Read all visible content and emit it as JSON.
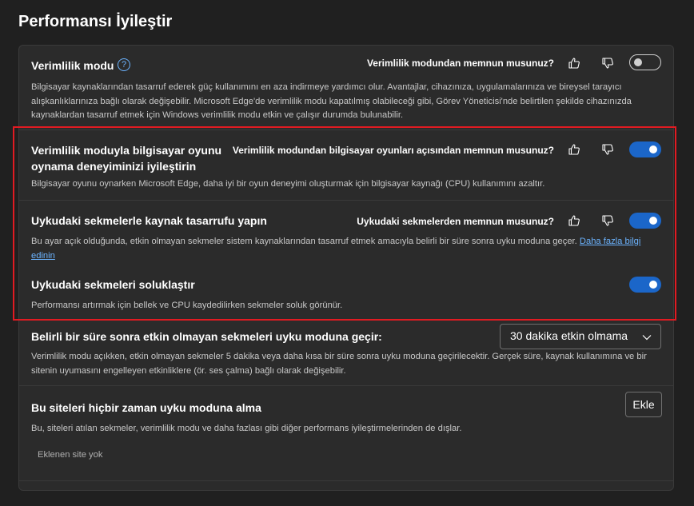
{
  "page": {
    "title": "Performansı İyileştir"
  },
  "efficiency": {
    "title": "Verimlilik modu",
    "help_icon": "help-circle-icon",
    "feedback_question": "Verimlilik modundan memnun musunuz?",
    "description": "Bilgisayar kaynaklarından tasarruf ederek güç kullanımını en aza indirmeye yardımcı olur. Avantajlar, cihazınıza, uygulamalarınıza ve bireysel tarayıcı alışkanlıklarınıza bağlı olarak değişebilir. Microsoft Edge'de verimlilik modu kapatılmış olabileceği gibi, Görev Yöneticisi'nde belirtilen şekilde cihazınızda kaynaklardan tasarruf etmek için Windows verimlilik modu etkin ve çalışır durumda bulunabilir.",
    "toggle_on": false
  },
  "gaming": {
    "title_line1": "Verimlilik moduyla bilgisayar oyunu",
    "title_line2": "oynama deneyiminizi iyileştirin",
    "feedback_question": "Verimlilik modundan bilgisayar oyunları açısından memnun musunuz?",
    "description": "Bilgisayar oyunu oynarken Microsoft Edge, daha iyi bir oyun deneyimi oluşturmak için bilgisayar kaynağı (CPU) kullanımını azaltır.",
    "toggle_on": true
  },
  "sleeping_tabs": {
    "title": "Uykudaki sekmelerle kaynak tasarrufu yapın",
    "feedback_question": "Uykudaki sekmelerden memnun musunuz?",
    "description": "Bu ayar açık olduğunda, etkin olmayan sekmeler sistem kaynaklarından tasarruf etmek amacıyla belirli bir süre sonra uyku moduna geçer.",
    "link_text": "Daha fazla bilgi edinin",
    "toggle_on": true
  },
  "fade_tabs": {
    "title": "Uykudaki sekmeleri soluklaştır",
    "description": "Performansı artırmak için bellek ve CPU kaydedilirken sekmeler soluk görünür.",
    "toggle_on": true
  },
  "sleep_after": {
    "title": "Belirli bir süre sonra etkin olmayan sekmeleri uyku moduna geçir:",
    "selected_option": "30 dakika etkin olmama",
    "description": "Verimlilik modu açıkken, etkin olmayan sekmeler 5 dakika veya daha kısa bir süre sonra uyku moduna geçirilecektir. Gerçek süre, kaynak kullanımına ve bir sitenin uyumasını engelleyen etkinliklere (ör. ses çalma) bağlı olarak değişebilir."
  },
  "never_sleep": {
    "title": "Bu siteleri hiçbir zaman uyku moduna alma",
    "add_label": "Ekle",
    "description": "Bu, siteleri atılan sekmeler, verimlilik modu ve daha fazlası gibi diğer performans iyileştirmelerinden de dışlar.",
    "empty_text": "Eklenen site yok"
  },
  "icons": {
    "thumbs_up": "thumbs-up-icon",
    "thumbs_down": "thumbs-down-icon",
    "chevron": "chevron-down-icon"
  },
  "colors": {
    "background": "#202020",
    "card": "#2b2b2b",
    "accent": "#1b66c9",
    "link": "#6cb4ff",
    "highlight": "#e11b22"
  }
}
